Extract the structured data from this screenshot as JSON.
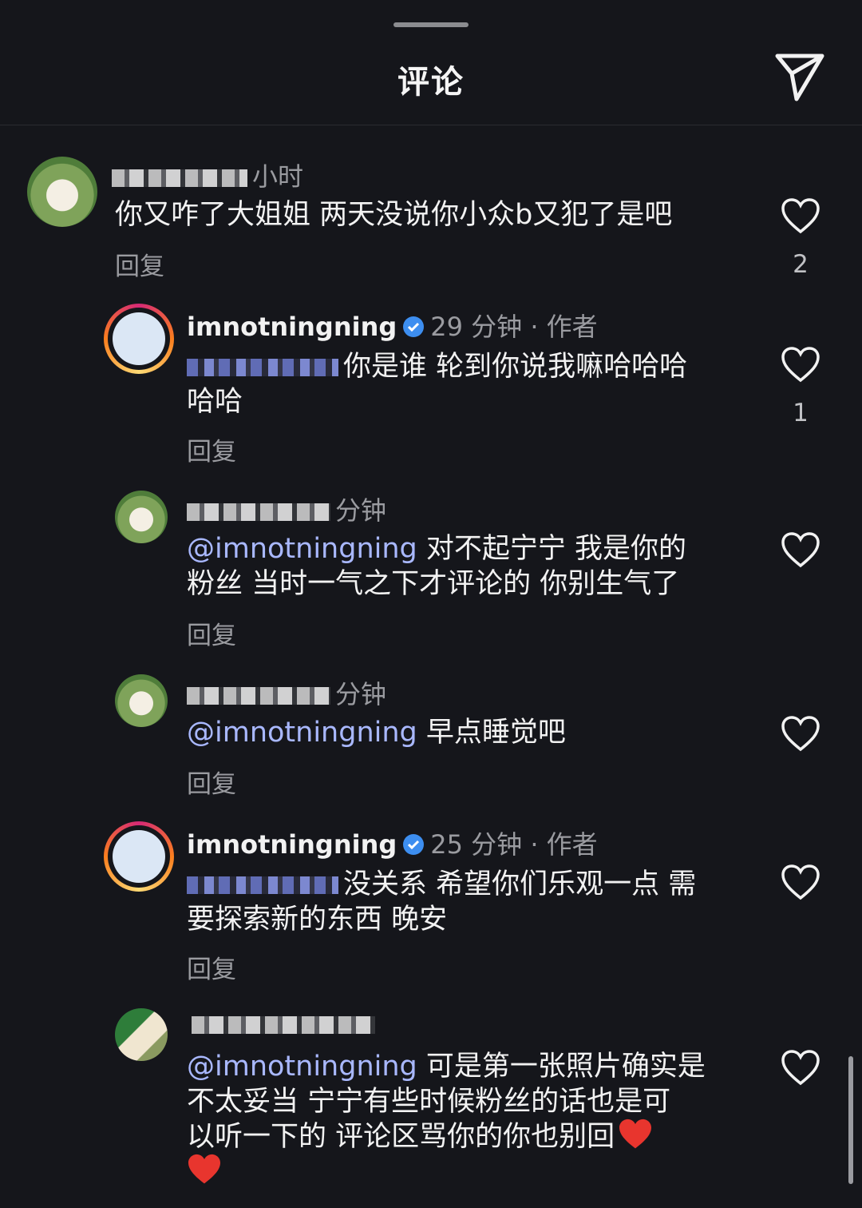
{
  "header": {
    "title": "评论"
  },
  "comments": [
    {
      "time": "小时",
      "text": "你又咋了大姐姐 两天没说你小众b又犯了是吧",
      "reply_label": "回复",
      "like_count": "2"
    },
    {
      "username": "imnotningning",
      "time": "29 分钟",
      "author_tag": "· 作者",
      "text_line1": "你是谁 轮到你说我嘛哈哈哈",
      "text_line2": "哈哈",
      "reply_label": "回复",
      "like_count": "1"
    },
    {
      "time": "分钟",
      "mention": "@imnotningning",
      "text_line1": "对不起宁宁 我是你的",
      "text_line2": "粉丝 当时一气之下才评论的 你别生气了",
      "reply_label": "回复"
    },
    {
      "time": "分钟",
      "mention": "@imnotningning",
      "text": "早点睡觉吧",
      "reply_label": "回复"
    },
    {
      "username": "imnotningning",
      "time": "25 分钟",
      "author_tag": "· 作者",
      "text_line1": "没关系 希望你们乐观一点 需",
      "text_line2": "要探索新的东西 晚安",
      "reply_label": "回复"
    },
    {
      "mention": "@imnotningning",
      "text_line1": "可是第一张照片确实是",
      "text_line2": "不太妥当 宁宁有些时候粉丝的话也是可",
      "text_line3": "以听一下的 评论区骂你的你也别回"
    }
  ],
  "colors": {
    "background": "#15161b",
    "mention": "#a9b8ff",
    "secondary_text": "#9a9ba0",
    "verified": "#3d8ef0"
  },
  "icons": [
    "share-send-icon",
    "heart-outline-icon",
    "verified-badge-icon",
    "red-heart-emoji-icon"
  ]
}
